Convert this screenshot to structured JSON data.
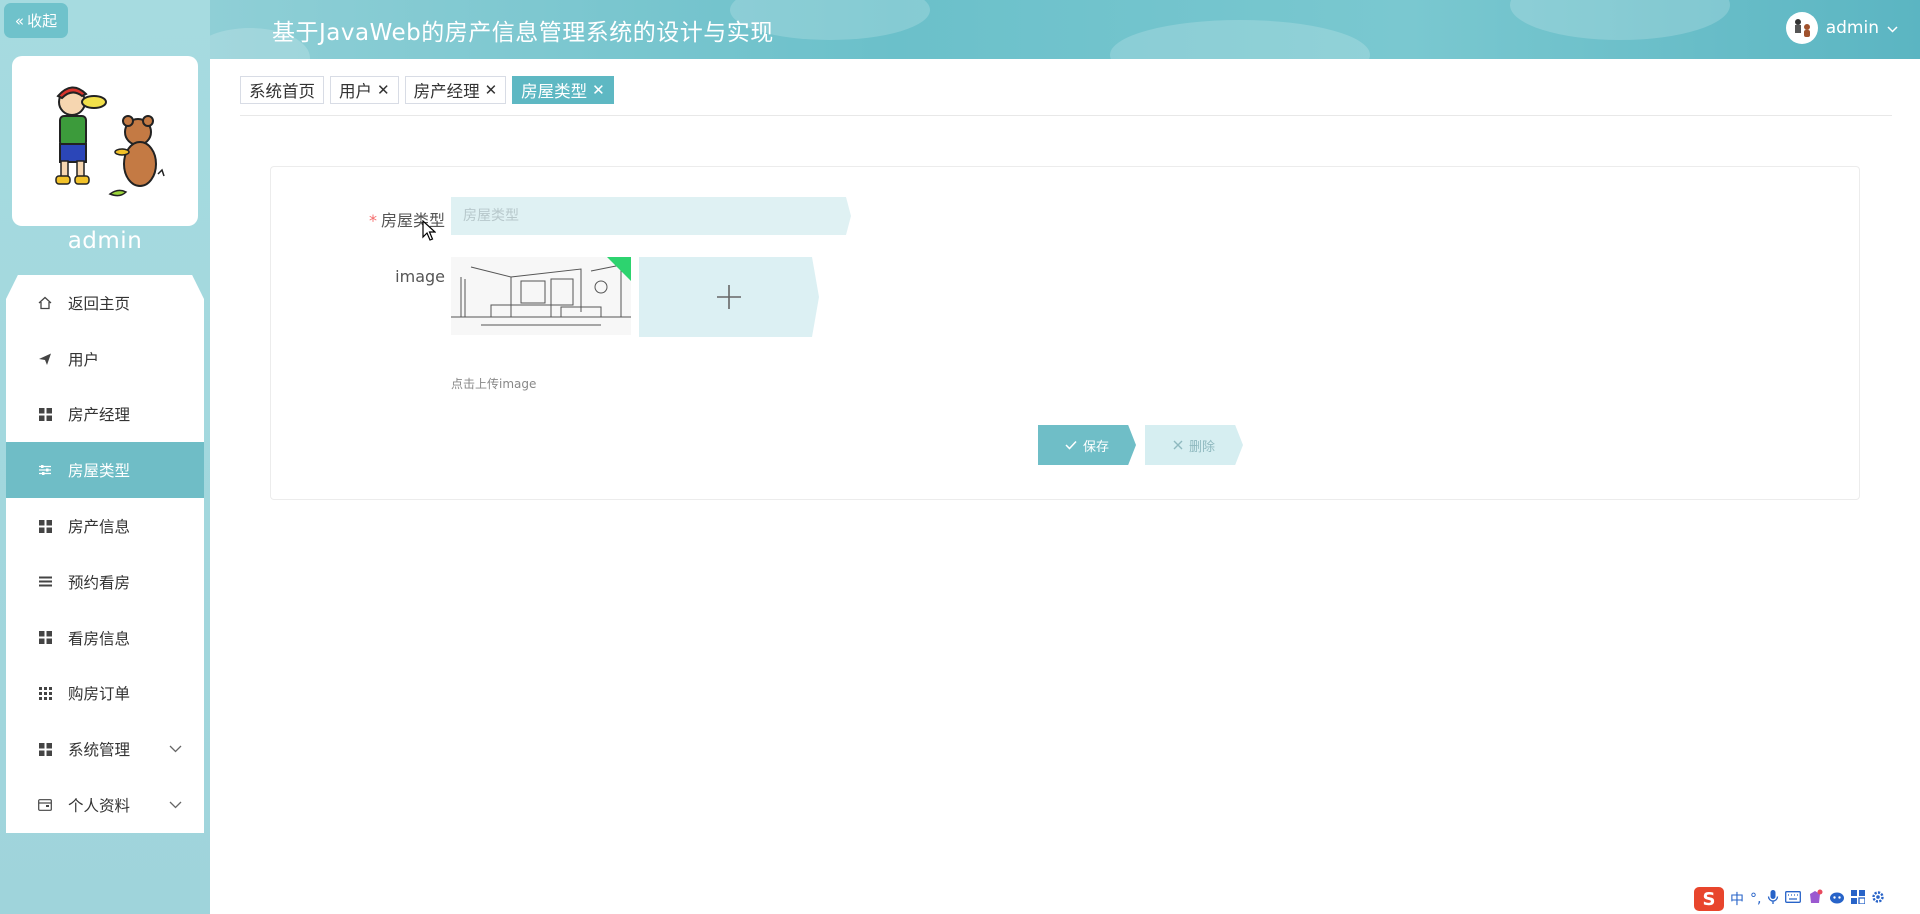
{
  "sidebar": {
    "collapse_label": "收起",
    "username": "admin",
    "items": [
      {
        "label": "返回主页",
        "icon": "home-icon"
      },
      {
        "label": "用户",
        "icon": "send-icon"
      },
      {
        "label": "房产经理",
        "icon": "grid-icon"
      },
      {
        "label": "房屋类型",
        "icon": "sliders-icon",
        "active": true
      },
      {
        "label": "房产信息",
        "icon": "grid-icon"
      },
      {
        "label": "预约看房",
        "icon": "list-icon"
      },
      {
        "label": "看房信息",
        "icon": "grid-icon"
      },
      {
        "label": "购房订单",
        "icon": "dots-grid-icon"
      },
      {
        "label": "系统管理",
        "icon": "grid-icon",
        "expandable": true
      },
      {
        "label": "个人资料",
        "icon": "wallet-icon",
        "expandable": true
      }
    ]
  },
  "header": {
    "title": "基于JavaWeb的房产信息管理系统的设计与实现",
    "user": "admin"
  },
  "tabs": [
    {
      "label": "系统首页",
      "closable": false
    },
    {
      "label": "用户",
      "closable": true
    },
    {
      "label": "房产经理",
      "closable": true
    },
    {
      "label": "房屋类型",
      "closable": true,
      "active": true
    }
  ],
  "form": {
    "type_label": "房屋类型",
    "type_required": "*",
    "type_placeholder": "房屋类型",
    "type_value": "",
    "image_label": "image",
    "upload_hint": "点击上传image",
    "save_label": "保存",
    "delete_label": "删除"
  },
  "ime": {
    "items": [
      "中",
      "°,"
    ]
  },
  "colors": {
    "accent": "#6fbdc6",
    "sidebar_bg": "#a6dbe0",
    "input_bg": "#dff1f3",
    "required": "#f56c6c"
  }
}
